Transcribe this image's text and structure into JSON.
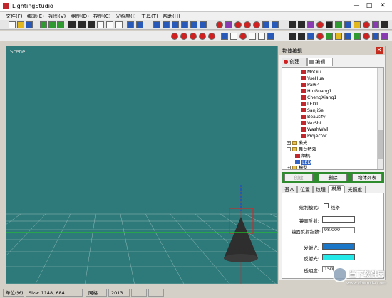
{
  "window": {
    "title": "LightingStudio",
    "minimize": "—",
    "maximize": "□",
    "close": "✕"
  },
  "menu": [
    "文件(F)",
    "编辑(E)",
    "视图(V)",
    "绘制(D)",
    "控制(C)",
    "光照度(I)",
    "工具(T)",
    "帮助(H)"
  ],
  "scene": {
    "label": "Scene"
  },
  "panel": {
    "title": "物体编辑",
    "close": "✕",
    "tabs": [
      {
        "label": "创建"
      },
      {
        "label": "编辑"
      }
    ],
    "tree_items": [
      "MoQiu",
      "YueHua",
      "Par64",
      "HuiGuang1",
      "ChengXiang1",
      "LED1",
      "SanJiSe",
      "Beautify",
      "WuShi",
      "WashWall",
      "Projector"
    ],
    "tree_folders": [
      {
        "label": "激光",
        "expander": "+"
      },
      {
        "label": "舞台特效",
        "expander": "−"
      },
      {
        "label": "烟机",
        "expander": ""
      },
      {
        "label": "LED",
        "expander": ""
      },
      {
        "label": "模型",
        "expander": "+"
      }
    ],
    "buttons": [
      {
        "label": "创建"
      },
      {
        "label": "删除"
      },
      {
        "label": "物体列表"
      }
    ],
    "attr_tabs": [
      "基本",
      "位置",
      "纹理",
      "材质",
      "光照度"
    ],
    "props": {
      "draw_mode_label": "绘制模式:",
      "wireframe_label": "线条",
      "specular_label": "镜面反射:",
      "specular_exp_label": "镜面反射指数:",
      "specular_exp_value": "98.000",
      "emissive_label": "发射光:",
      "reflect_label": "反射光:",
      "transparency_label": "透明度:",
      "transparency_value": "150",
      "specular_color": "#ffffff",
      "emissive_color": "#1b76c8",
      "reflect_color": "#24e8e8"
    }
  },
  "status": {
    "unit": "单位(米)",
    "size": "Size: 1148, 684",
    "grid": "网格",
    "year": "2013"
  },
  "watermark": {
    "text": "当下软件园",
    "url": "www.downxia.com"
  }
}
